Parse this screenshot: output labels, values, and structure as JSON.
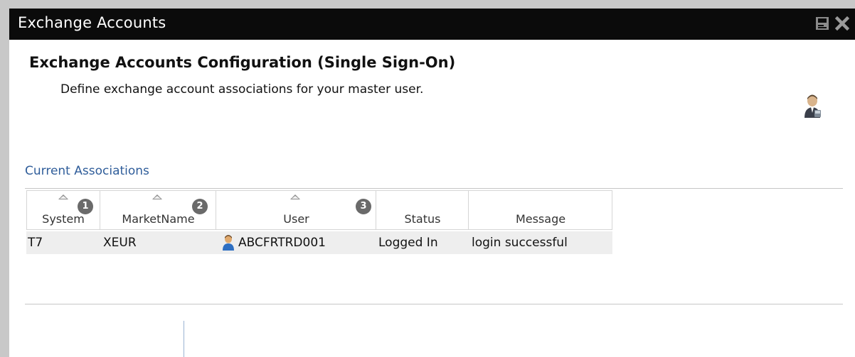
{
  "window": {
    "title": "Exchange Accounts"
  },
  "titlebar_icons": [
    "save-icon",
    "close-icon"
  ],
  "page": {
    "heading": "Exchange Accounts Configuration (Single Sign-On)",
    "description": "Define exchange account associations for your master user.",
    "header_icon": "user-admin-icon"
  },
  "associations": {
    "section_label": "Current Associations",
    "columns": [
      {
        "label": "System",
        "sort_badge": "1"
      },
      {
        "label": "MarketName",
        "sort_badge": "2"
      },
      {
        "label": "User",
        "sort_badge": "3"
      },
      {
        "label": "Status"
      },
      {
        "label": "Message"
      }
    ],
    "rows": [
      {
        "system": "T7",
        "market_name": "XEUR",
        "user": "ABCFRTRD001",
        "status": "Logged In",
        "message": "login successful"
      }
    ]
  },
  "colors": {
    "titlebar_bg": "#0b0b0b",
    "link_blue": "#2f5d9a",
    "badge_gray": "#6a6a6a"
  }
}
